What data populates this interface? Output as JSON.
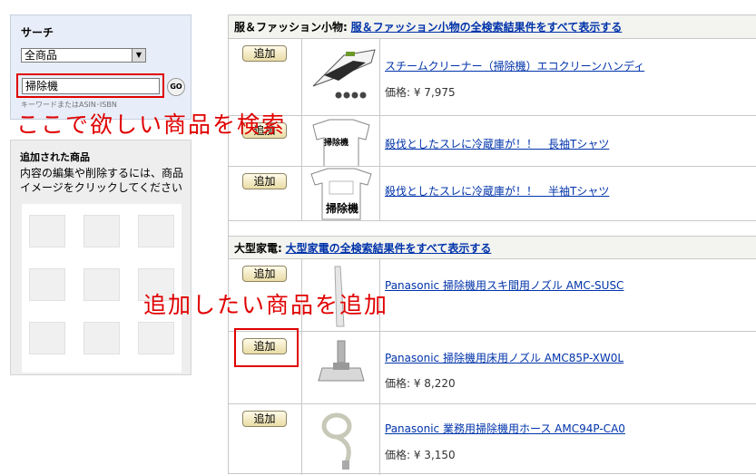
{
  "search": {
    "title": "サーチ",
    "category_selected": "全商品",
    "keyword_value": "掃除機",
    "go_label": "GO",
    "hint": "キーワードまたはASIN･ISBN"
  },
  "added": {
    "title": "追加された商品",
    "description": "内容の編集や削除するには、商品イメージをクリックしてください"
  },
  "categories": [
    {
      "name": "服＆ファッション小物:",
      "link": "服＆ファッション小物の全検索結果件をすべて表示する"
    },
    {
      "name": "大型家電:",
      "link": "大型家電の全検索結果件をすべて表示する"
    }
  ],
  "add_label": "追加",
  "products": [
    {
      "name": "スチームクリーナー（掃除機）エコクリーンハンディ",
      "price": "価格: ¥ 7,975",
      "image_label": ""
    },
    {
      "name": "殺伐としたスレに冷蔵庫が！！　長袖Tシャツ",
      "price": "",
      "image_label": "掃除機"
    },
    {
      "name": "殺伐としたスレに冷蔵庫が！！　半袖Tシャツ",
      "price": "",
      "image_label": "掃除機"
    },
    {
      "name": "Panasonic 掃除機用スキ間用ノズル AMC-SUSC",
      "price": "",
      "image_label": ""
    },
    {
      "name": "Panasonic 掃除機用床用ノズル AMC85P-XW0L",
      "price": "価格: ¥ 8,220",
      "image_label": ""
    },
    {
      "name": "Panasonic 業務用掃除機用ホース AMC94P-CA0",
      "price": "価格: ¥ 3,150",
      "image_label": ""
    }
  ],
  "annotations": {
    "search_note": "ここで欲しい商品を検索",
    "add_note": "追加したい商品を追加"
  },
  "colors": {
    "annotation": "#e00000",
    "link": "#0033aa"
  }
}
